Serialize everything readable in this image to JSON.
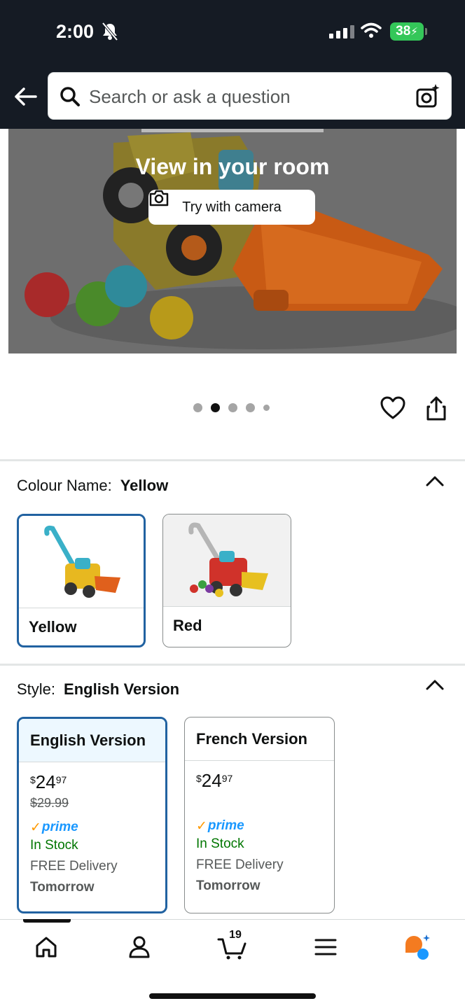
{
  "status_bar": {
    "time": "2:00",
    "battery": "38"
  },
  "header": {
    "search_placeholder": "Search or ask a question"
  },
  "hero": {
    "title": "View in your room",
    "try_button": "Try with camera"
  },
  "carousel": {
    "dot_count": 5,
    "active_index": 1
  },
  "colour": {
    "label": "Colour Name:",
    "value": "Yellow",
    "options": [
      {
        "name": "Yellow",
        "selected": true
      },
      {
        "name": "Red",
        "selected": false
      }
    ]
  },
  "style": {
    "label": "Style:",
    "value": "English Version",
    "options": [
      {
        "name": "English Version",
        "selected": true,
        "currency": "$",
        "price_whole": "24",
        "price_fraction": "97",
        "list_price": "$29.99",
        "prime": "prime",
        "stock": "In Stock",
        "delivery": "FREE Delivery",
        "delivery_day": "Tomorrow"
      },
      {
        "name": "French Version",
        "selected": false,
        "currency": "$",
        "price_whole": "24",
        "price_fraction": "97",
        "list_price": "",
        "prime": "prime",
        "stock": "In Stock",
        "delivery": "FREE Delivery",
        "delivery_day": "Tomorrow"
      }
    ]
  },
  "tab_bar": {
    "cart_count": "19"
  },
  "colors": {
    "header_bg": "#151b24",
    "selected_border": "#2162a1",
    "in_stock": "#007600",
    "prime_blue": "#1a98ff",
    "prime_check": "#ff9900",
    "battery_green": "#34c759"
  },
  "icons": {
    "back": "arrow-left-icon",
    "search": "search-icon",
    "lens": "camera-lens-icon",
    "heart": "heart-icon",
    "share": "share-icon",
    "home": "home-icon",
    "account": "user-icon",
    "cart": "cart-icon",
    "menu": "menu-icon",
    "ai": "ai-assistant-icon"
  }
}
